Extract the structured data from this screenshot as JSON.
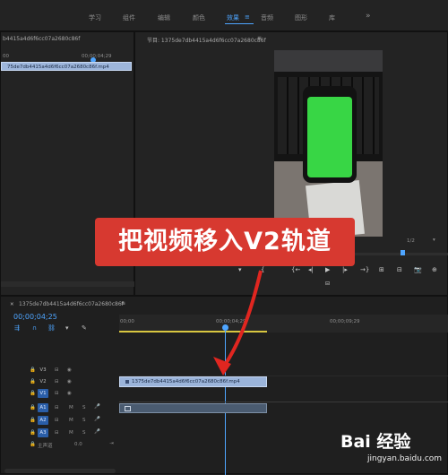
{
  "workspaces": [
    "学习",
    "组件",
    "编辑",
    "颜色",
    "效果",
    "音频",
    "图形",
    "库"
  ],
  "workspace_active_index": 4,
  "workspace_menu_glyph": "≡",
  "overflow_glyph": "»",
  "source_panel": {
    "title": "b4415a4d6f6cc07a2680c86f",
    "ruler_left": "00",
    "ruler_time": "00;00;04;29",
    "clip_name": "75de7db4415a4d6f6cc07a2680c86f.mp4"
  },
  "program_monitor": {
    "title": "节目: 1375de7db4415a4d6f6cc07a2680c86f",
    "menu_glyph": "≡",
    "resolution": "1/2",
    "transport": [
      "{",
      "{←",
      "◂|",
      "▶",
      "|▸",
      "→}",
      "⊞",
      "⊟",
      "📷",
      "⊕"
    ]
  },
  "sequence": {
    "name": "1375de7db4415a4d6f6cc07a2680c86f",
    "menu_glyph": "≡",
    "timecode": "00;00;04;25",
    "ruler_labels": [
      "00;00",
      "00;00;04;29",
      "00;00;09;29"
    ],
    "video_tracks": [
      {
        "label": "V3",
        "target": false
      },
      {
        "label": "V2",
        "target": false
      },
      {
        "label": "V1",
        "target": true
      }
    ],
    "audio_tracks": [
      {
        "label": "A1",
        "m": "M",
        "s": "S",
        "target": true
      },
      {
        "label": "A2",
        "m": "M",
        "s": "S",
        "target": true
      },
      {
        "label": "A3",
        "m": "M",
        "s": "S",
        "target": true
      }
    ],
    "master_label": "主声道",
    "master_value": "0.0",
    "v2_clip": "1375de7db4415a4d6f6cc07a2680c86f.mp4"
  },
  "annotation": {
    "caption": "把视频移入V2轨道",
    "caption_color": "#d73930"
  },
  "watermark": {
    "brand": "Bai 经验",
    "url": "jingyan.baidu.com"
  }
}
